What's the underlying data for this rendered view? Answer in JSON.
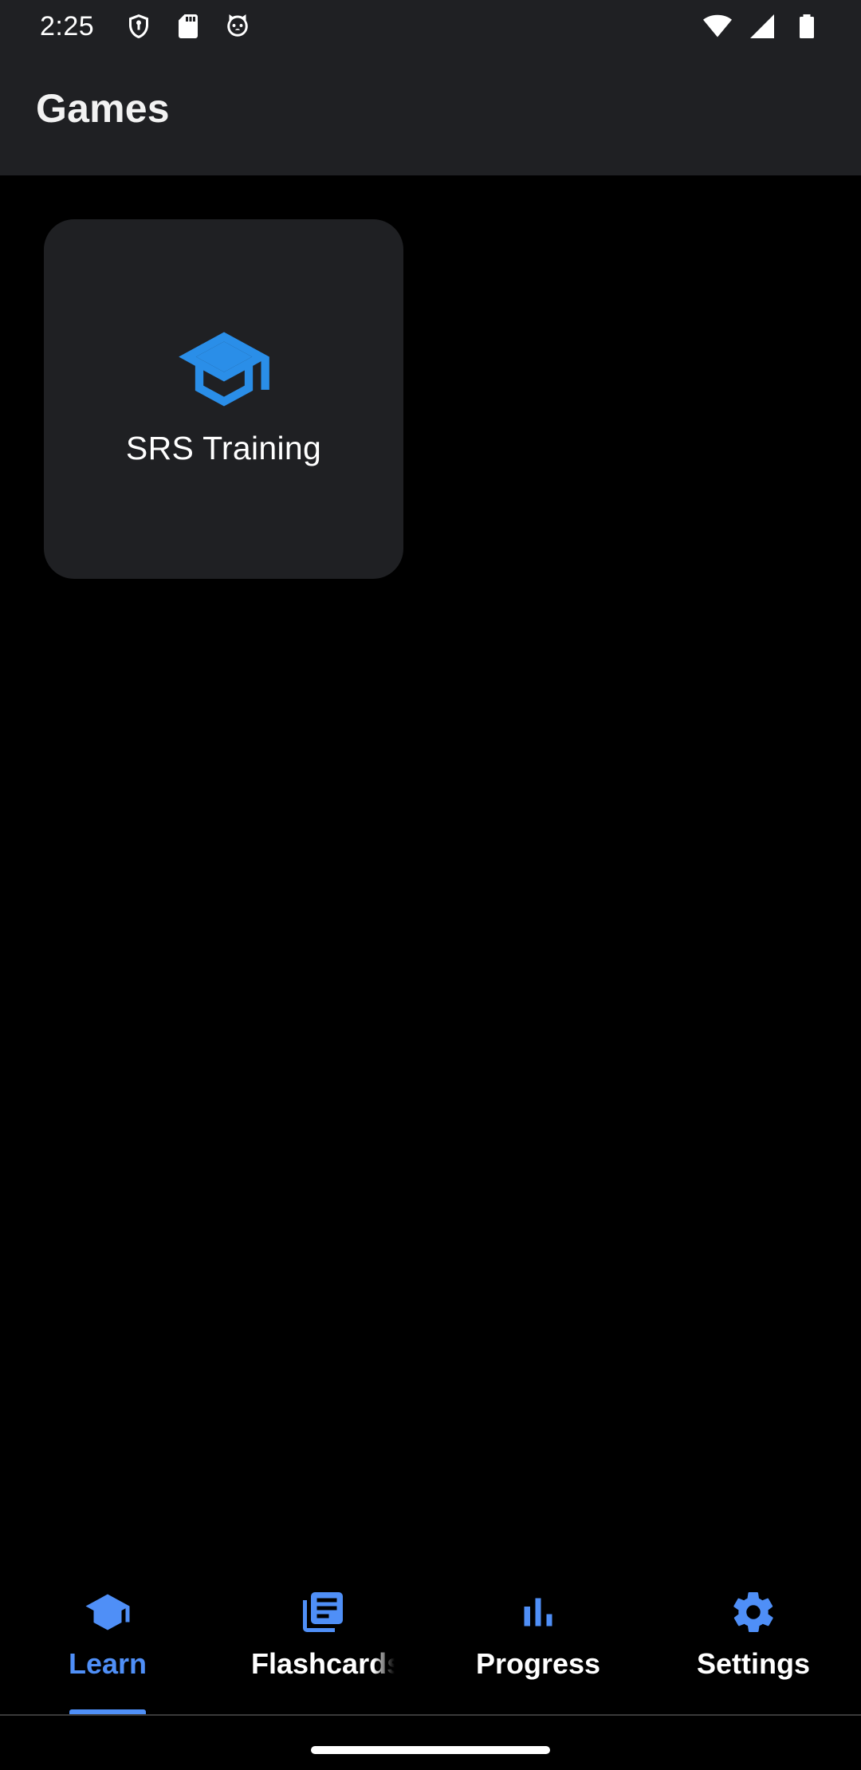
{
  "status_bar": {
    "time": "2:25",
    "left_icons": [
      "shield-icon",
      "sd-card-icon",
      "cat-face-icon"
    ],
    "right_icons": [
      "wifi-icon",
      "cellular-signal-icon",
      "battery-icon"
    ]
  },
  "app_bar": {
    "title": "Games"
  },
  "games": [
    {
      "label": "SRS Training",
      "icon": "graduation-cap-icon"
    }
  ],
  "bottom_nav": {
    "items": [
      {
        "label": "Learn",
        "icon": "graduation-cap-icon",
        "active": true
      },
      {
        "label": "Flashcards",
        "icon": "cards-stack-icon",
        "active": false
      },
      {
        "label": "Progress",
        "icon": "bar-chart-icon",
        "active": false
      },
      {
        "label": "Settings",
        "icon": "gear-icon",
        "active": false
      }
    ]
  },
  "colors": {
    "accent": "#2a8ee8",
    "nav_active": "#4f8ff7",
    "surface": "#1f2023",
    "background": "#000000",
    "text": "#ffffff"
  }
}
